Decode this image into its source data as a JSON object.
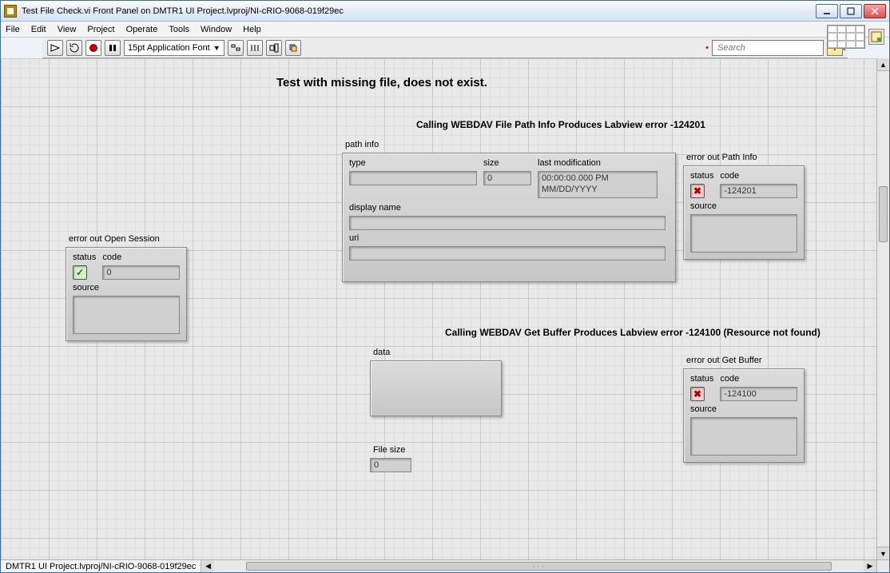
{
  "window": {
    "title": "Test File Check.vi Front Panel on DMTR1 UI Project.lvproj/NI-cRIO-9068-019f29ec"
  },
  "menu": [
    "File",
    "Edit",
    "View",
    "Project",
    "Operate",
    "Tools",
    "Window",
    "Help"
  ],
  "toolbar": {
    "font": "15pt Application Font",
    "search_placeholder": "Search",
    "help": "?"
  },
  "headline": "Test with missing file, does not exist.",
  "sub1": "Calling WEBDAV File Path Info Produces Labview error -124201",
  "sub2": "Calling WEBDAV Get Buffer Produces Labview error -124100  (Resource not found)",
  "path_info": {
    "title": "path info",
    "type_label": "type",
    "type_val": "",
    "size_label": "size",
    "size_val": "0",
    "mod_label": "last modification",
    "mod_val": "00:00:00.000 PM\nMM/DD/YYYY",
    "display_label": "display name",
    "display_val": "",
    "uri_label": "uri",
    "uri_val": ""
  },
  "err_open": {
    "title": "error out Open Session",
    "status_label": "status",
    "code_label": "code",
    "source_label": "source",
    "status": "ok",
    "code": "0",
    "source": ""
  },
  "err_path": {
    "title": "error out Path Info",
    "status_label": "status",
    "code_label": "code",
    "source_label": "source",
    "status": "err",
    "code": "-124201",
    "source": ""
  },
  "err_buf": {
    "title": "error out Get Buffer",
    "status_label": "status",
    "code_label": "code",
    "source_label": "source",
    "status": "err",
    "code": "-124100",
    "source": ""
  },
  "data_block": {
    "title": "data"
  },
  "filesize": {
    "label": "File size",
    "val": "0"
  },
  "status_project": "DMTR1 UI Project.lvproj/NI-cRIO-9068-019f29ec"
}
